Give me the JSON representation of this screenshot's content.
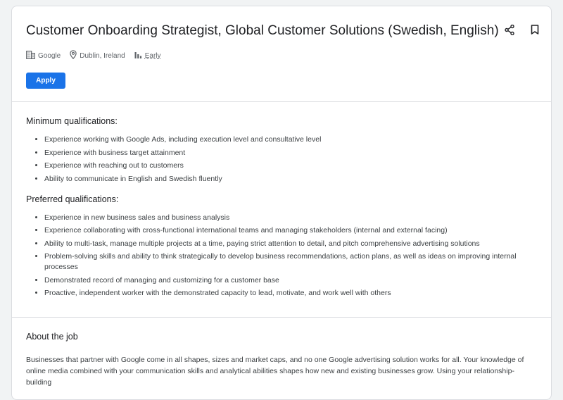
{
  "job": {
    "title": "Customer Onboarding Strategist, Global Customer Solutions (Swedish, English)",
    "company": "Google",
    "location": "Dublin, Ireland",
    "level": "Early",
    "apply_label": "Apply"
  },
  "actions": {
    "share_icon": "share-icon",
    "bookmark_icon": "bookmark-icon"
  },
  "minimum": {
    "heading": "Minimum qualifications:",
    "items": [
      "Experience working with Google Ads, including execution level and consultative level",
      "Experience with business target attainment",
      "Experience with reaching out to customers",
      "Ability to communicate in English and Swedish fluently"
    ]
  },
  "preferred": {
    "heading": "Preferred qualifications:",
    "items": [
      "Experience in new business sales and business analysis",
      "Experience collaborating with cross-functional international teams and managing stakeholders (internal and external facing)",
      "Ability to multi-task, manage multiple projects at a time, paying strict attention to detail, and pitch comprehensive advertising solutions",
      "Problem-solving skills and ability to think strategically to develop business recommendations, action plans, as well as ideas on improving internal processes",
      "Demonstrated record of managing and customizing for a customer base",
      "Proactive, independent worker with the demonstrated capacity to lead, motivate, and work well with others"
    ]
  },
  "about": {
    "heading": "About the job",
    "text": "Businesses that partner with Google come in all shapes, sizes and market caps, and no one Google advertising solution works for all. Your knowledge of online media combined with your communication skills and analytical abilities shapes how new and existing businesses grow. Using your relationship-building"
  },
  "colors": {
    "accent": "#1a73e8",
    "border": "#dadce0",
    "muted": "#5f6368"
  }
}
